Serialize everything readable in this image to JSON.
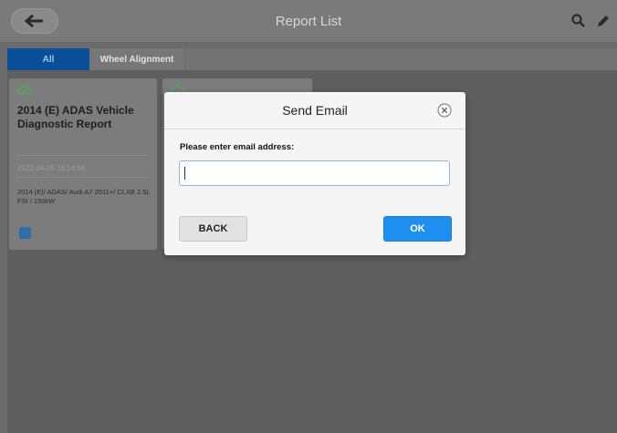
{
  "header": {
    "title": "Report List",
    "back_icon": "back-arrow-icon",
    "search_icon": "search-icon",
    "edit_icon": "pencil-icon"
  },
  "tabs": [
    {
      "label": "All",
      "selected": true
    },
    {
      "label": "Wheel Alignment",
      "selected": false
    }
  ],
  "cards": [
    {
      "icon": "cloud-check-icon",
      "title": "2014 (E) ADAS Vehicle Diagnostic Report",
      "date": "2022-04-05 10:14:56",
      "description": "2014 (E)/ ADAS/ Audi A7 2011+/ CLXB 2.5L FSI / 150kW",
      "badge_icon": "report-icon"
    },
    {
      "icon": "cloud-check-icon"
    }
  ],
  "dialog": {
    "title": "Send Email",
    "close_icon": "close-circle-icon",
    "prompt": "Please enter email address:",
    "email_value": "",
    "back_label": "BACK",
    "ok_label": "OK"
  },
  "colors": {
    "accent": "#1e8ef0",
    "tab_selected": "#0a4f9a",
    "cloud_icon": "#4fae4f"
  }
}
